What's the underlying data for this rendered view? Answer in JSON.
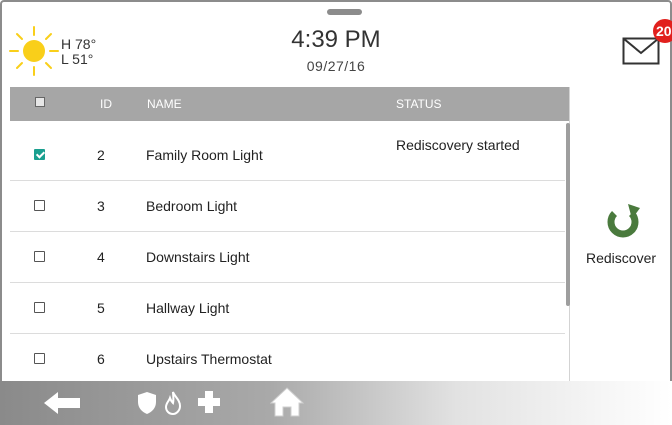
{
  "weather": {
    "icon": "sun-icon",
    "high": "H 78°",
    "low": "L 51°"
  },
  "clock": {
    "time": "4:39 PM",
    "date": "09/27/16"
  },
  "mail": {
    "icon": "envelope-icon",
    "badge": "20",
    "badge_color": "#e1201d"
  },
  "table": {
    "headers": {
      "id": "ID",
      "name": "NAME",
      "status": "STATUS"
    },
    "rows": [
      {
        "checked": true,
        "id": "2",
        "name": "Family Room Light",
        "status": "Rediscovery started"
      },
      {
        "checked": false,
        "id": "3",
        "name": "Bedroom Light",
        "status": ""
      },
      {
        "checked": false,
        "id": "4",
        "name": "Downstairs Light",
        "status": ""
      },
      {
        "checked": false,
        "id": "5",
        "name": "Hallway Light",
        "status": ""
      },
      {
        "checked": false,
        "id": "6",
        "name": "Upstairs Thermostat",
        "status": ""
      }
    ]
  },
  "actions": {
    "rediscover_label": "Rediscover",
    "icon": "refresh-icon",
    "accent": "#4a7a3d"
  },
  "nav": {
    "icons": [
      "back-arrow-icon",
      "shield-icon",
      "fire-icon",
      "medical-cross-icon",
      "home-icon"
    ]
  },
  "colors": {
    "checkbox_checked": "#1a9f8f",
    "header_bg": "#a6a6a6"
  }
}
